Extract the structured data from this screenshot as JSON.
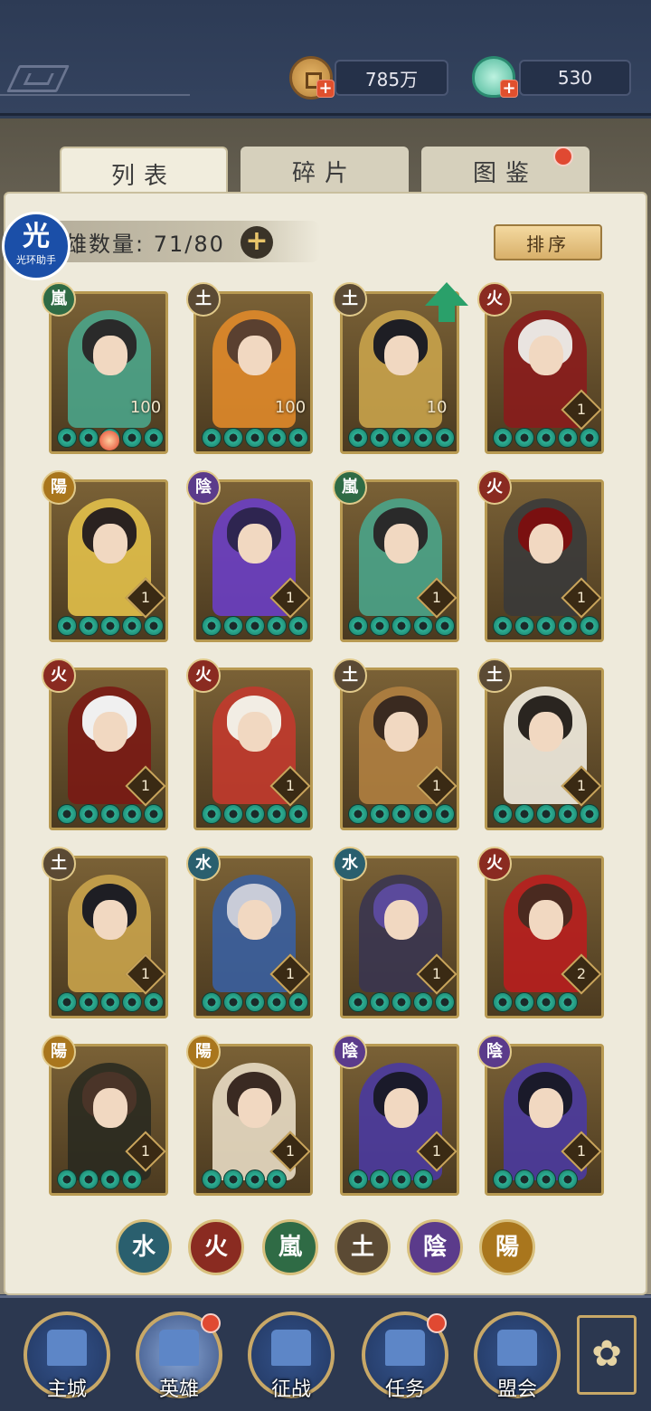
{
  "resources": {
    "copper": "785万",
    "jade": "530"
  },
  "tabs": [
    {
      "label": "列表",
      "active": true
    },
    {
      "label": "碎片",
      "active": false
    },
    {
      "label": "图鉴",
      "active": false,
      "badge": true
    }
  ],
  "list": {
    "count_label": "雄数量: 71/80",
    "add_symbol": "+",
    "sort_label": "排序"
  },
  "watermark": {
    "big": "光",
    "small": "光环助手"
  },
  "heroes": [
    {
      "element": "嵐",
      "etype": "wind",
      "level": "100",
      "stars": 5,
      "hair": "#2a2a2a",
      "cloth": "#4aa48a"
    },
    {
      "element": "土",
      "etype": "earth",
      "level": "100",
      "stars": 5,
      "hair": "#5a4030",
      "cloth": "#e08a2a"
    },
    {
      "element": "土",
      "etype": "earth",
      "level": "10",
      "stars": 5,
      "hair": "#1e1e24",
      "cloth": "#c9a34b"
    },
    {
      "element": "火",
      "etype": "fire",
      "level": "1",
      "stars": 5,
      "hair": "#e9e4e0",
      "cloth": "#8a1c1c"
    },
    {
      "element": "陽",
      "etype": "yang",
      "level": "1",
      "stars": 5,
      "hair": "#2a2220",
      "cloth": "#e2c04a"
    },
    {
      "element": "陰",
      "etype": "yin",
      "level": "1",
      "stars": 5,
      "hair": "#2e2550",
      "cloth": "#6a3ec4"
    },
    {
      "element": "嵐",
      "etype": "wind",
      "level": "1",
      "stars": 5,
      "hair": "#2a2a2a",
      "cloth": "#4aa48a"
    },
    {
      "element": "火",
      "etype": "fire",
      "level": "1",
      "stars": 5,
      "hair": "#7a1010",
      "cloth": "#3a3a3a"
    },
    {
      "element": "火",
      "etype": "fire",
      "level": "1",
      "stars": 5,
      "hair": "#f0f0f0",
      "cloth": "#7a1a14"
    },
    {
      "element": "火",
      "etype": "fire",
      "level": "1",
      "stars": 5,
      "hair": "#f2ede4",
      "cloth": "#c23a2e"
    },
    {
      "element": "土",
      "etype": "earth",
      "level": "1",
      "stars": 5,
      "hair": "#3a2a20",
      "cloth": "#b08040"
    },
    {
      "element": "土",
      "etype": "earth",
      "level": "1",
      "stars": 5,
      "hair": "#2a2520",
      "cloth": "#f1ece0"
    },
    {
      "element": "土",
      "etype": "earth",
      "level": "1",
      "stars": 5,
      "hair": "#1e1e24",
      "cloth": "#c9a34b"
    },
    {
      "element": "水",
      "etype": "water",
      "level": "1",
      "stars": 5,
      "hair": "#c9ccd8",
      "cloth": "#3a5fa0"
    },
    {
      "element": "水",
      "etype": "water",
      "level": "1",
      "stars": 5,
      "hair": "#5b4a9c",
      "cloth": "#3a3550"
    },
    {
      "element": "火",
      "etype": "fire",
      "level": "2",
      "stars": 4,
      "hair": "#4a2a20",
      "cloth": "#b81e1e"
    },
    {
      "element": "陽",
      "etype": "yang",
      "level": "1",
      "stars": 4,
      "hair": "#4a3428",
      "cloth": "#2a2a20"
    },
    {
      "element": "陽",
      "etype": "yang",
      "level": "1",
      "stars": 4,
      "hair": "#3a2a22",
      "cloth": "#e8dcc4"
    },
    {
      "element": "陰",
      "etype": "yin",
      "level": "1",
      "stars": 4,
      "hair": "#1a1a2a",
      "cloth": "#4a3aa0"
    },
    {
      "element": "陰",
      "etype": "yin",
      "level": "1",
      "stars": 4,
      "hair": "#1a1a2a",
      "cloth": "#4a3aa0"
    }
  ],
  "filters": [
    {
      "element": "水",
      "etype": "water"
    },
    {
      "element": "火",
      "etype": "fire"
    },
    {
      "element": "嵐",
      "etype": "wind"
    },
    {
      "element": "土",
      "etype": "earth"
    },
    {
      "element": "陰",
      "etype": "yin"
    },
    {
      "element": "陽",
      "etype": "yang"
    }
  ],
  "nav": [
    {
      "label": "主城",
      "active": false,
      "badge": false
    },
    {
      "label": "英雄",
      "active": true,
      "badge": true
    },
    {
      "label": "征战",
      "active": false,
      "badge": false
    },
    {
      "label": "任务",
      "active": false,
      "badge": true
    },
    {
      "label": "盟会",
      "active": false,
      "badge": false
    }
  ]
}
